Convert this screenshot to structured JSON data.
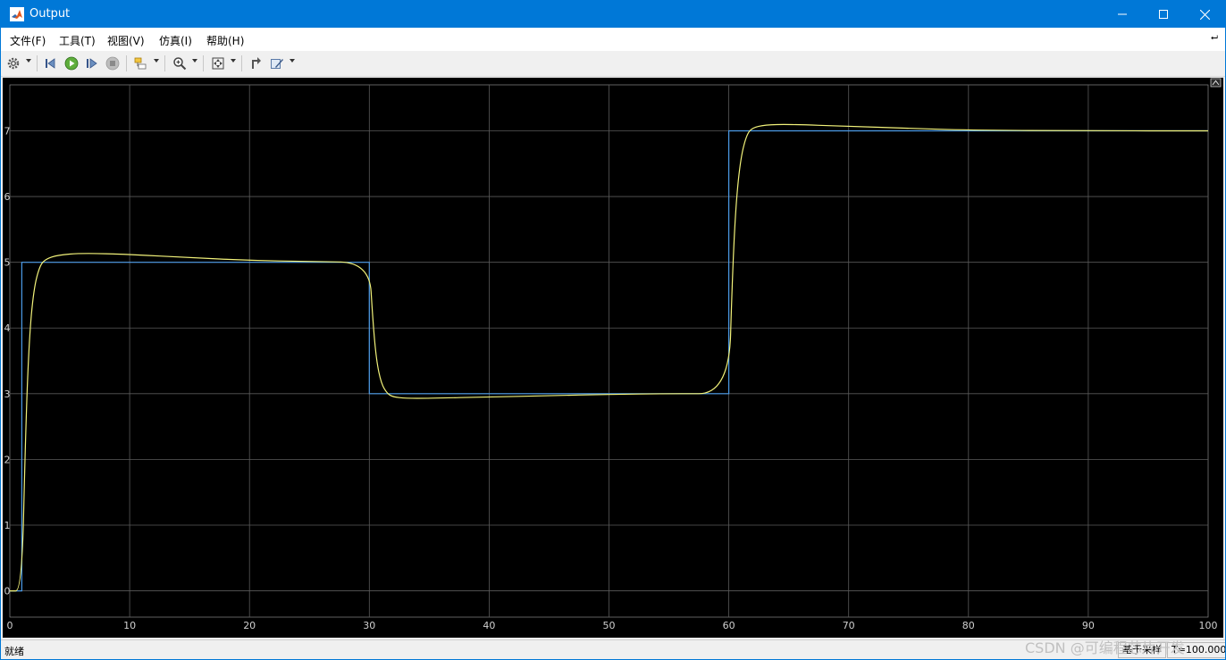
{
  "window": {
    "title": "Output",
    "icon": "matlab-logo-icon"
  },
  "menu": [
    {
      "label": "文件(F)"
    },
    {
      "label": "工具(T)"
    },
    {
      "label": "视图(V)"
    },
    {
      "label": "仿真(I)"
    },
    {
      "label": "帮助(H)"
    }
  ],
  "toolbar": {
    "icons": [
      "gear-icon",
      "restore-step-icon",
      "run-icon",
      "step-forward-icon",
      "stop-icon",
      "highlight-block-icon",
      "zoom-icon",
      "autoscale-icon",
      "snap-icon",
      "style-icon"
    ]
  },
  "status": {
    "text": "就绪",
    "sample_label": "基于采样",
    "time": "T=100.000"
  },
  "watermark": "CSDN @可编程芯片开发",
  "colors": {
    "titlebar": "#0078d7",
    "plot_bg": "#000000",
    "reference": "#4c9be8",
    "output": "#f2f27a"
  },
  "chart_data": {
    "type": "line",
    "xlim": [
      0,
      100
    ],
    "ylim": [
      -0.4,
      7.7
    ],
    "xticks": [
      "0",
      "10",
      "20",
      "30",
      "40",
      "50",
      "60",
      "70",
      "80",
      "90",
      "100"
    ],
    "yticks": [
      "0",
      "1",
      "2",
      "3",
      "4",
      "5",
      "6",
      "7"
    ],
    "grid": true,
    "series": [
      {
        "x": [
          0,
          1,
          1,
          30,
          30,
          60,
          60,
          100
        ],
        "y": [
          0,
          0,
          5,
          5,
          3,
          3,
          7,
          7
        ]
      },
      {
        "x": [
          0,
          1,
          1.3,
          1.6,
          2,
          2.5,
          3,
          4,
          6,
          10,
          15,
          20,
          25,
          30,
          30.3,
          30.6,
          31,
          31.5,
          32,
          33,
          35,
          40,
          45,
          50,
          55,
          60,
          60.3,
          60.6,
          61,
          61.5,
          62,
          63,
          65,
          70,
          75,
          80,
          90,
          100
        ],
        "y": [
          0,
          0,
          2.3,
          3.8,
          4.6,
          4.95,
          5.05,
          5.11,
          5.14,
          5.12,
          5.07,
          5.03,
          5.01,
          5.0,
          4.1,
          3.5,
          3.15,
          3.0,
          2.95,
          2.93,
          2.93,
          2.95,
          2.97,
          2.99,
          3.0,
          3.0,
          4.8,
          5.9,
          6.6,
          6.95,
          7.05,
          7.09,
          7.1,
          7.07,
          7.04,
          7.01,
          7.0,
          7.0
        ]
      }
    ]
  }
}
